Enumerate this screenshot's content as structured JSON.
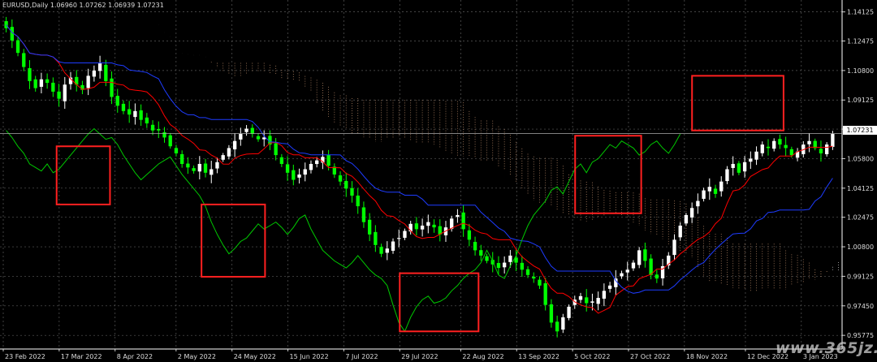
{
  "header": {
    "title": "EURUSD,Daily  1.06960 1.07262 1.06939 1.07231"
  },
  "price_tag": "1.07231",
  "watermark": "www.365jz.com",
  "colors": {
    "background": "#000000",
    "grid": "#5a5a5a",
    "axis": "#ffffff",
    "bull": "#ffffff",
    "bear": "#00ff00",
    "tenkan": "#ff0000",
    "kijun": "#1e3cff",
    "chikou": "#00c800",
    "cloud_bull": "#e8e8e8",
    "cloud_bear": "#d9a27a",
    "highlight_box": "#ff2020"
  },
  "chart_data": {
    "type": "candlestick",
    "symbol": "EURUSD",
    "timeframe": "Daily",
    "indicator": "Ichimoku Kinko Hyo",
    "ylim": [
      0.95,
      1.148
    ],
    "y_ticks": [
      "1.14125",
      "1.12475",
      "1.10800",
      "1.09125",
      "1.07475",
      "1.05800",
      "1.04125",
      "1.02475",
      "1.00800",
      "0.99125",
      "0.97450",
      "0.95775"
    ],
    "x_ticks": [
      "23 Feb 2022",
      "17 Mar 2022",
      "8 Apr 2022",
      "2 May 2022",
      "24 May 2022",
      "15 Jun 2022",
      "7 Jul 2022",
      "29 Jul 2022",
      "22 Aug 2022",
      "13 Sep 2022",
      "5 Oct 2022",
      "27 Oct 2022",
      "18 Nov 2022",
      "12 Dec 2022",
      "3 Jan 2023"
    ],
    "last_close": 1.07231,
    "closes": [
      1.132,
      1.125,
      1.118,
      1.11,
      1.102,
      1.098,
      1.103,
      1.101,
      1.096,
      1.092,
      1.1,
      1.104,
      1.1,
      1.097,
      1.105,
      1.108,
      1.112,
      1.102,
      1.093,
      1.088,
      1.085,
      1.083,
      1.085,
      1.08,
      1.078,
      1.074,
      1.074,
      1.07,
      1.065,
      1.061,
      1.055,
      1.053,
      1.051,
      1.055,
      1.05,
      1.052,
      1.056,
      1.06,
      1.064,
      1.068,
      1.072,
      1.075,
      1.072,
      1.069,
      1.07,
      1.066,
      1.06,
      1.055,
      1.05,
      1.046,
      1.049,
      1.052,
      1.055,
      1.057,
      1.059,
      1.054,
      1.049,
      1.045,
      1.041,
      1.037,
      1.031,
      1.022,
      1.015,
      1.009,
      1.004,
      1.007,
      1.011,
      1.013,
      1.017,
      1.021,
      1.018,
      1.02,
      1.022,
      1.019,
      1.015,
      1.019,
      1.024,
      1.026,
      1.018,
      1.012,
      1.006,
      1.003,
      1.0,
      0.998,
      0.996,
      0.999,
      1.003,
      0.999,
      0.995,
      0.992,
      0.99,
      0.986,
      0.975,
      0.965,
      0.96,
      0.968,
      0.974,
      0.978,
      0.98,
      0.976,
      0.977,
      0.979,
      0.983,
      0.986,
      0.99,
      0.993,
      0.995,
      0.999,
      1.006,
      1.0,
      0.992,
      0.99,
      0.997,
      1.003,
      1.012,
      1.02,
      1.026,
      1.03,
      1.034,
      1.04,
      1.042,
      1.038,
      1.045,
      1.052,
      1.055,
      1.05,
      1.056,
      1.058,
      1.062,
      1.066,
      1.064,
      1.068,
      1.066,
      1.064,
      1.06,
      1.062,
      1.066,
      1.068,
      1.064,
      1.061,
      1.066,
      1.072
    ],
    "annotations": [
      {
        "type": "box",
        "from": "2022-03-16",
        "to": "2022-04-06",
        "y_high": 1.065,
        "y_low": 1.032
      },
      {
        "type": "box",
        "from": "2022-05-12",
        "to": "2022-06-06",
        "y_high": 1.032,
        "y_low": 0.991
      },
      {
        "type": "box",
        "from": "2022-07-29",
        "to": "2022-08-29",
        "y_high": 0.993,
        "y_low": 0.96
      },
      {
        "type": "box",
        "from": "2022-10-06",
        "to": "2022-11-01",
        "y_high": 1.071,
        "y_low": 1.027
      },
      {
        "type": "box",
        "from": "2022-11-21",
        "to": "2022-12-27",
        "y_high": 1.105,
        "y_low": 1.074
      }
    ]
  }
}
